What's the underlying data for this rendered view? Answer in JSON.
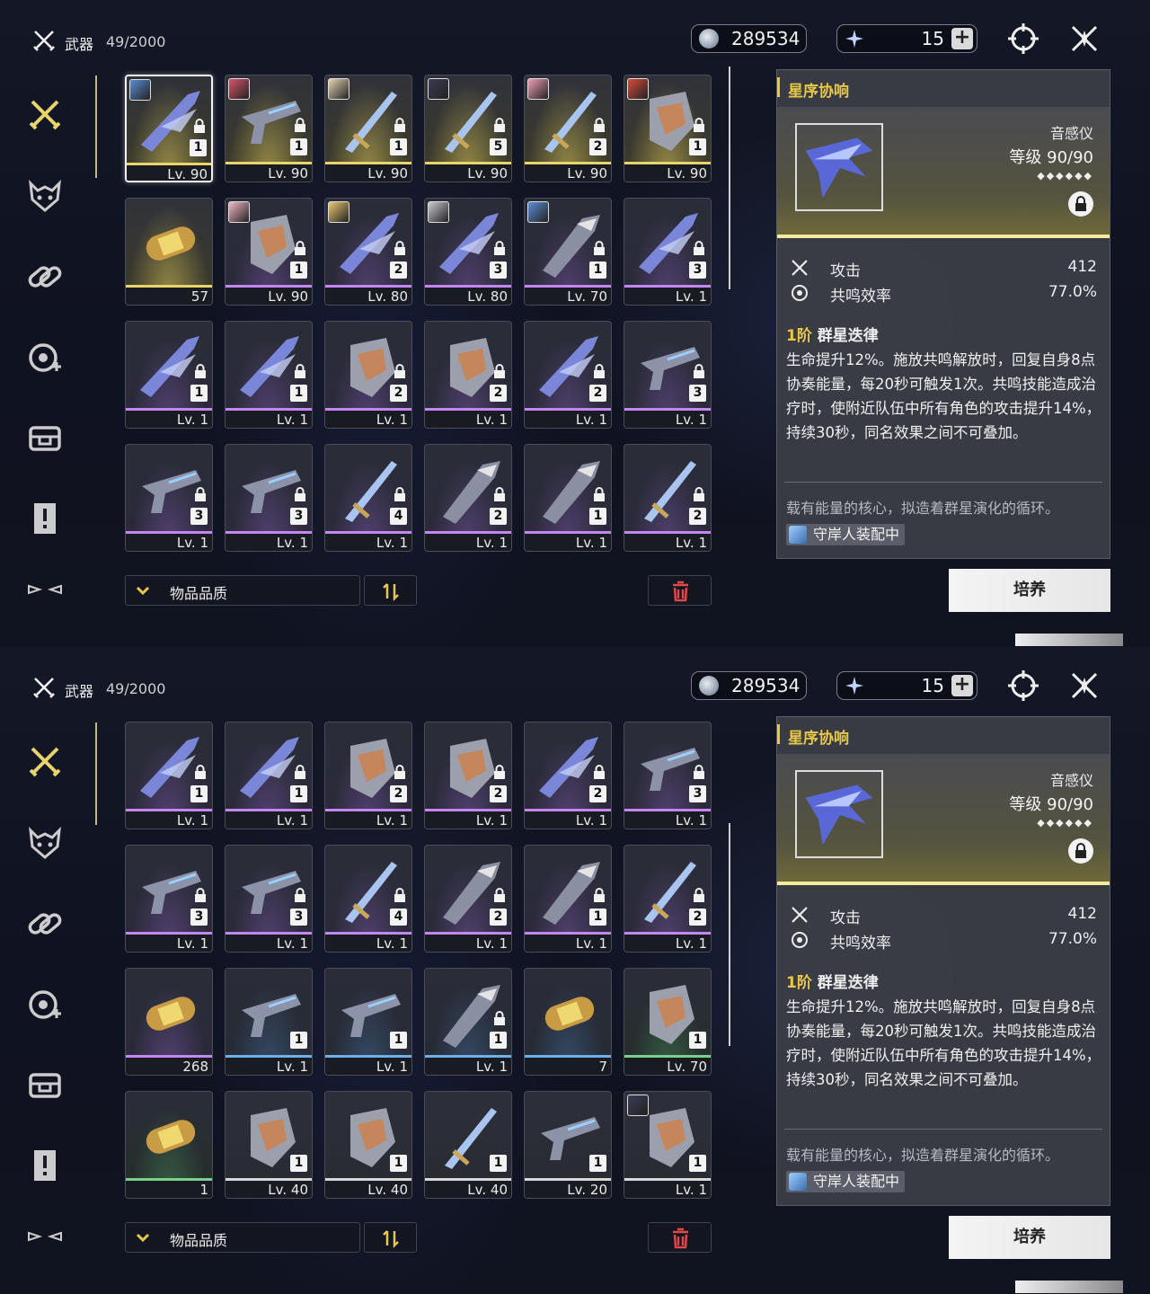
{
  "header": {
    "title": "武器",
    "count": "49/2000",
    "coins": "289534",
    "stars": "15",
    "plus": "+"
  },
  "detail": {
    "title": "星序协响",
    "type": "音感仪",
    "level": "等级 90/90",
    "stars": "◆◆◆◆◆◆",
    "stats": [
      {
        "name": "攻击",
        "value": "412"
      },
      {
        "name": "共鸣效率",
        "value": "77.0%"
      }
    ],
    "skill_rank": "1阶",
    "skill_name": "群星迭律",
    "skill_desc": "生命提升12%。施放共鸣解放时，回复自身8点协奏能量，每20秒可触发1次。共鸣技能造成治疗时，使附近队伍中所有角色的攻击提升14%，持续30秒，同名效果之间不可叠加。",
    "flavor": "载有能量的核心，拟造着群星演化的循环。",
    "equipped": "守岸人装配中",
    "cultivate": "培养"
  },
  "sort": {
    "label": "物品品质"
  },
  "colors": {
    "accent": "#e8c84a",
    "gold": "#e8d46a",
    "purple": "#c487f2",
    "blue": "#6fb0e8",
    "green": "#7ad08a"
  },
  "screen1": {
    "items": [
      {
        "rarity": "gold",
        "label": "Lv. 90",
        "rank": "1",
        "avatar": true,
        "locked": true,
        "icon": "blade-icon",
        "selected": true
      },
      {
        "rarity": "gold",
        "label": "Lv. 90",
        "rank": "1",
        "avatar": true,
        "locked": true,
        "icon": "gun-icon"
      },
      {
        "rarity": "gold",
        "label": "Lv. 90",
        "rank": "1",
        "avatar": true,
        "locked": true,
        "icon": "sword-icon"
      },
      {
        "rarity": "gold",
        "label": "Lv. 90",
        "rank": "5",
        "avatar": true,
        "locked": true,
        "icon": "sword-icon"
      },
      {
        "rarity": "gold",
        "label": "Lv. 90",
        "rank": "2",
        "avatar": true,
        "locked": true,
        "icon": "sword-icon"
      },
      {
        "rarity": "gold",
        "label": "Lv. 90",
        "rank": "1",
        "avatar": true,
        "locked": true,
        "icon": "gauntlet-icon"
      },
      {
        "rarity": "gold",
        "label": "57",
        "rank": "",
        "avatar": false,
        "locked": false,
        "icon": "capsule-icon"
      },
      {
        "rarity": "purple",
        "label": "Lv. 90",
        "rank": "1",
        "avatar": true,
        "locked": true,
        "icon": "gauntlet-icon"
      },
      {
        "rarity": "purple",
        "label": "Lv. 80",
        "rank": "2",
        "avatar": true,
        "locked": true,
        "icon": "blade-icon"
      },
      {
        "rarity": "purple",
        "label": "Lv. 80",
        "rank": "3",
        "avatar": true,
        "locked": true,
        "icon": "blade-icon"
      },
      {
        "rarity": "purple",
        "label": "Lv. 70",
        "rank": "1",
        "avatar": true,
        "locked": true,
        "icon": "broadblade-icon"
      },
      {
        "rarity": "purple",
        "label": "Lv. 1",
        "rank": "3",
        "avatar": false,
        "locked": true,
        "icon": "blade-icon"
      },
      {
        "rarity": "purple",
        "label": "Lv. 1",
        "rank": "1",
        "avatar": false,
        "locked": true,
        "icon": "blade-icon"
      },
      {
        "rarity": "purple",
        "label": "Lv. 1",
        "rank": "1",
        "avatar": false,
        "locked": true,
        "icon": "blade-icon"
      },
      {
        "rarity": "purple",
        "label": "Lv. 1",
        "rank": "2",
        "avatar": false,
        "locked": true,
        "icon": "gauntlet-icon"
      },
      {
        "rarity": "purple",
        "label": "Lv. 1",
        "rank": "2",
        "avatar": false,
        "locked": true,
        "icon": "gauntlet-icon"
      },
      {
        "rarity": "purple",
        "label": "Lv. 1",
        "rank": "2",
        "avatar": false,
        "locked": true,
        "icon": "blade-icon"
      },
      {
        "rarity": "purple",
        "label": "Lv. 1",
        "rank": "3",
        "avatar": false,
        "locked": true,
        "icon": "gun-icon"
      },
      {
        "rarity": "purple",
        "label": "Lv. 1",
        "rank": "3",
        "avatar": false,
        "locked": true,
        "icon": "gun-icon"
      },
      {
        "rarity": "purple",
        "label": "Lv. 1",
        "rank": "3",
        "avatar": false,
        "locked": true,
        "icon": "gun-icon"
      },
      {
        "rarity": "purple",
        "label": "Lv. 1",
        "rank": "4",
        "avatar": false,
        "locked": true,
        "icon": "sword-icon"
      },
      {
        "rarity": "purple",
        "label": "Lv. 1",
        "rank": "2",
        "avatar": false,
        "locked": true,
        "icon": "broadblade-icon"
      },
      {
        "rarity": "purple",
        "label": "Lv. 1",
        "rank": "1",
        "avatar": false,
        "locked": true,
        "icon": "broadblade-icon"
      },
      {
        "rarity": "purple",
        "label": "Lv. 1",
        "rank": "2",
        "avatar": false,
        "locked": true,
        "icon": "sword-icon"
      }
    ]
  },
  "screen2": {
    "items": [
      {
        "rarity": "purple",
        "label": "Lv. 1",
        "rank": "1",
        "avatar": false,
        "locked": true,
        "icon": "blade-icon"
      },
      {
        "rarity": "purple",
        "label": "Lv. 1",
        "rank": "1",
        "avatar": false,
        "locked": true,
        "icon": "blade-icon"
      },
      {
        "rarity": "purple",
        "label": "Lv. 1",
        "rank": "2",
        "avatar": false,
        "locked": true,
        "icon": "gauntlet-icon"
      },
      {
        "rarity": "purple",
        "label": "Lv. 1",
        "rank": "2",
        "avatar": false,
        "locked": true,
        "icon": "gauntlet-icon"
      },
      {
        "rarity": "purple",
        "label": "Lv. 1",
        "rank": "2",
        "avatar": false,
        "locked": true,
        "icon": "blade-icon"
      },
      {
        "rarity": "purple",
        "label": "Lv. 1",
        "rank": "3",
        "avatar": false,
        "locked": true,
        "icon": "gun-icon"
      },
      {
        "rarity": "purple",
        "label": "Lv. 1",
        "rank": "3",
        "avatar": false,
        "locked": true,
        "icon": "gun-icon"
      },
      {
        "rarity": "purple",
        "label": "Lv. 1",
        "rank": "3",
        "avatar": false,
        "locked": true,
        "icon": "gun-icon"
      },
      {
        "rarity": "purple",
        "label": "Lv. 1",
        "rank": "4",
        "avatar": false,
        "locked": true,
        "icon": "sword-icon"
      },
      {
        "rarity": "purple",
        "label": "Lv. 1",
        "rank": "2",
        "avatar": false,
        "locked": true,
        "icon": "broadblade-icon"
      },
      {
        "rarity": "purple",
        "label": "Lv. 1",
        "rank": "1",
        "avatar": false,
        "locked": true,
        "icon": "broadblade-icon"
      },
      {
        "rarity": "purple",
        "label": "Lv. 1",
        "rank": "2",
        "avatar": false,
        "locked": true,
        "icon": "sword-icon"
      },
      {
        "rarity": "purple",
        "label": "268",
        "rank": "",
        "avatar": false,
        "locked": false,
        "icon": "capsule-icon"
      },
      {
        "rarity": "blue",
        "label": "Lv. 1",
        "rank": "1",
        "avatar": false,
        "locked": false,
        "icon": "gun-icon"
      },
      {
        "rarity": "blue",
        "label": "Lv. 1",
        "rank": "1",
        "avatar": false,
        "locked": false,
        "icon": "gun-icon"
      },
      {
        "rarity": "blue",
        "label": "Lv. 1",
        "rank": "1",
        "avatar": false,
        "locked": true,
        "icon": "broadblade-icon"
      },
      {
        "rarity": "blue",
        "label": "7",
        "rank": "",
        "avatar": false,
        "locked": false,
        "icon": "capsule-icon"
      },
      {
        "rarity": "green",
        "label": "Lv. 70",
        "rank": "1",
        "avatar": false,
        "locked": false,
        "icon": "gauntlet-icon"
      },
      {
        "rarity": "green",
        "label": "1",
        "rank": "",
        "avatar": false,
        "locked": false,
        "icon": "capsule-icon"
      },
      {
        "rarity": "white",
        "label": "Lv. 40",
        "rank": "1",
        "avatar": false,
        "locked": false,
        "icon": "gauntlet-icon"
      },
      {
        "rarity": "white",
        "label": "Lv. 40",
        "rank": "1",
        "avatar": false,
        "locked": false,
        "icon": "gauntlet-icon"
      },
      {
        "rarity": "white",
        "label": "Lv. 40",
        "rank": "1",
        "avatar": false,
        "locked": false,
        "icon": "sword-icon"
      },
      {
        "rarity": "white",
        "label": "Lv. 20",
        "rank": "1",
        "avatar": false,
        "locked": false,
        "icon": "gun-icon"
      },
      {
        "rarity": "white",
        "label": "Lv. 1",
        "rank": "1",
        "avatar": true,
        "locked": false,
        "icon": "gauntlet-icon"
      }
    ]
  }
}
